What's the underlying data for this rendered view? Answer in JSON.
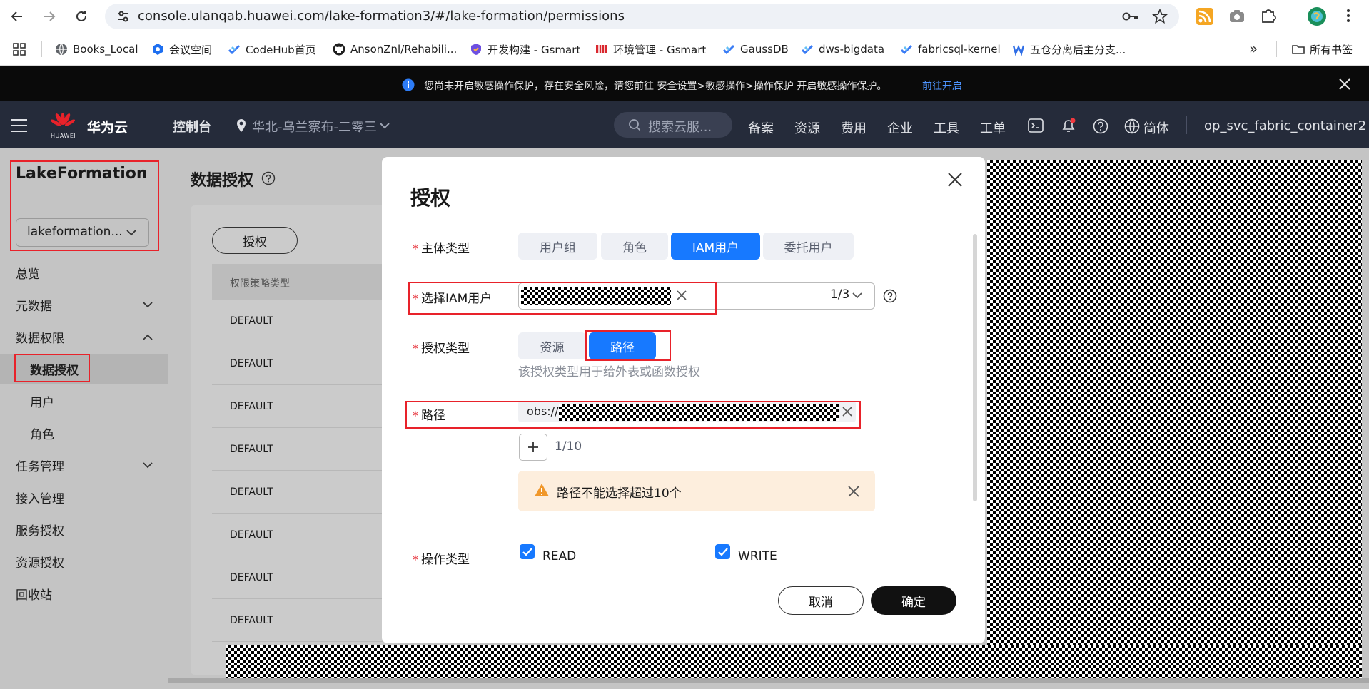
{
  "browser": {
    "url": "console.ulanqab.huawei.com/lake-formation3/#/lake-formation/permissions",
    "bookmarks": [
      "Books_Local",
      "会议空间",
      "CodeHub首页",
      "AnsonZnl/Rehabili...",
      "开发构建 - Gsmart",
      "环境管理 - Gsmart",
      "GaussDB",
      "dws-bigdata",
      "fabricsql-kernel",
      "五仓分离后主分支..."
    ],
    "more_bookmarks": "»",
    "all_bookmarks": "所有书签"
  },
  "notice": {
    "text": "您尚未开启敏感操作保护，存在安全风险，请您前往 安全设置>敏感操作>操作保护 开启敏感操作保护。",
    "link": "前往开启"
  },
  "header": {
    "brand_caption": "HUAWEI",
    "brand": "华为云",
    "console": "控制台",
    "region": "华北-乌兰察布-二零三",
    "search_placeholder": "搜索云服...",
    "nav": [
      "备案",
      "资源",
      "费用",
      "企业",
      "工具",
      "工单"
    ],
    "language": "简体",
    "username": "op_svc_fabric_container2"
  },
  "sidebar": {
    "title": "LakeFormation",
    "instance": "lakeformation...",
    "menu": {
      "overview": "总览",
      "metadata": "元数据",
      "data_permissions": "数据权限",
      "data_authorization": "数据授权",
      "users": "用户",
      "roles": "角色",
      "task_management": "任务管理",
      "access_management": "接入管理",
      "service_authorization": "服务授权",
      "resource_authorization": "资源授权",
      "recycle_bin": "回收站"
    }
  },
  "main": {
    "title": "数据授权",
    "grant_button": "授权",
    "column_header": "权限策略类型",
    "rows": [
      "DEFAULT",
      "DEFAULT",
      "DEFAULT",
      "DEFAULT",
      "DEFAULT",
      "DEFAULT",
      "DEFAULT",
      "DEFAULT"
    ]
  },
  "dialog": {
    "title": "授权",
    "principal_type_label": "主体类型",
    "principal_types": [
      "用户组",
      "角色",
      "IAM用户",
      "委托用户"
    ],
    "principal_selected": "IAM用户",
    "iam_user_label": "选择IAM用户",
    "iam_user_count": "1/3",
    "auth_type_label": "授权类型",
    "auth_types": [
      "资源",
      "路径"
    ],
    "auth_selected": "路径",
    "auth_type_hint": "该授权类型用于给外表或函数授权",
    "path_label": "路径",
    "path_prefix": "obs://",
    "path_count": "1/10",
    "warning_text": "路径不能选择超过10个",
    "operation_label": "操作类型",
    "operations": [
      {
        "label": "READ",
        "checked": true
      },
      {
        "label": "WRITE",
        "checked": true
      }
    ],
    "cancel_button": "取消",
    "confirm_button": "确定"
  },
  "colors": {
    "primary": "#1779ff",
    "annotation_red": "#e8222a",
    "header_bg": "#252b3a",
    "warning_bg": "#fdeedd",
    "warning_icon": "#f0972a"
  }
}
